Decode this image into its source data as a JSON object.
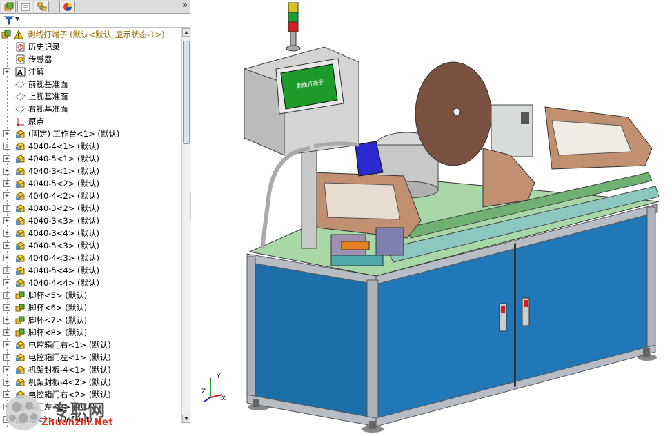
{
  "window": {
    "collapse_glyph": "»"
  },
  "tabs": [
    {
      "name": "feature-manager-tab",
      "icon": "feature-tree-icon"
    },
    {
      "name": "property-manager-tab",
      "icon": "property-icon"
    },
    {
      "name": "configuration-manager-tab",
      "icon": "configuration-icon"
    },
    {
      "name": "appearance-tab",
      "icon": "appearance-icon"
    }
  ],
  "filter": {
    "icon": "filter-icon",
    "arrow": "▼"
  },
  "tree": {
    "root": {
      "label": "剥线打端子  (默认<默认_显示状态-1>)",
      "icon": "assembly-warning-icon"
    },
    "items": [
      {
        "label": "历史记录",
        "icon": "history-icon",
        "expand": false
      },
      {
        "label": "传感器",
        "icon": "sensor-icon",
        "expand": false
      },
      {
        "label": "注解",
        "icon": "annotation-icon",
        "expand": true
      },
      {
        "label": "前视基准面",
        "icon": "plane-icon",
        "expand": false
      },
      {
        "label": "上视基准面",
        "icon": "plane-icon",
        "expand": false
      },
      {
        "label": "右视基准面",
        "icon": "plane-icon",
        "expand": false
      },
      {
        "label": "原点",
        "icon": "origin-icon",
        "expand": false
      },
      {
        "label": "(固定) 工作台<1> (默认)",
        "icon": "part-icon",
        "expand": true
      },
      {
        "label": "4040-4<1> (默认)",
        "icon": "part-icon",
        "expand": true
      },
      {
        "label": "4040-5<1> (默认)",
        "icon": "part-icon",
        "expand": true
      },
      {
        "label": "4040-3<1> (默认)",
        "icon": "part-icon",
        "expand": true
      },
      {
        "label": "4040-5<2> (默认)",
        "icon": "part-icon",
        "expand": true
      },
      {
        "label": "4040-4<2> (默认)",
        "icon": "part-icon",
        "expand": true
      },
      {
        "label": "4040-3<2> (默认)",
        "icon": "part-icon",
        "expand": true
      },
      {
        "label": "4040-3<3> (默认)",
        "icon": "part-icon",
        "expand": true
      },
      {
        "label": "4040-3<4> (默认)",
        "icon": "part-icon",
        "expand": true
      },
      {
        "label": "4040-5<3> (默认)",
        "icon": "part-icon",
        "expand": true
      },
      {
        "label": "4040-4<3> (默认)",
        "icon": "part-icon",
        "expand": true
      },
      {
        "label": "4040-5<4> (默认)",
        "icon": "part-icon",
        "expand": true
      },
      {
        "label": "4040-4<4> (默认)",
        "icon": "part-icon",
        "expand": true
      },
      {
        "label": "脚杯<5> (默认)",
        "icon": "subassembly-icon",
        "expand": true
      },
      {
        "label": "脚杯<6> (默认)",
        "icon": "subassembly-icon",
        "expand": true
      },
      {
        "label": "脚杯<7> (默认)",
        "icon": "subassembly-icon",
        "expand": true
      },
      {
        "label": "脚杯<8> (默认)",
        "icon": "subassembly-icon",
        "expand": true
      },
      {
        "label": "电控箱门右<1> (默认)",
        "icon": "part-icon",
        "expand": true
      },
      {
        "label": "电控箱门左<1> (默认)",
        "icon": "part-icon",
        "expand": true
      },
      {
        "label": "机架封板-4<1> (默认)",
        "icon": "part-icon",
        "expand": true
      },
      {
        "label": "机架封板-4<2> (默认)",
        "icon": "part-icon",
        "expand": true
      },
      {
        "label": "电控箱门右<2> (默认)",
        "icon": "part-icon",
        "expand": true
      },
      {
        "label": "箱门左<2> (默认)",
        "icon": "part-icon",
        "expand": true
      },
      {
        "label": "箱<1> (Default)",
        "icon": "part-icon",
        "expand": true
      }
    ]
  },
  "watermark": {
    "cn": "专职网",
    "url": "Zhuanzhi.Net"
  },
  "screen": {
    "hmi": "剥线打端子"
  },
  "triad": {
    "x": "X",
    "y": "Y",
    "z": "Z"
  }
}
